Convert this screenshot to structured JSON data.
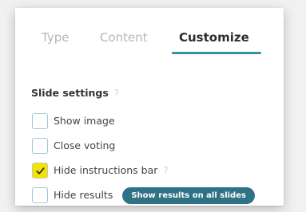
{
  "tabs": [
    {
      "label": "Type",
      "active": false
    },
    {
      "label": "Content",
      "active": false
    },
    {
      "label": "Customize",
      "active": true
    }
  ],
  "colors": {
    "accent": "#3b90a3",
    "pill": "#2f7286",
    "checkbox_checked": "#f3e400",
    "checkbox_border": "#9fc7d6"
  },
  "slide_settings": {
    "title": "Slide settings",
    "help_icon": "?",
    "options": [
      {
        "label": "Show image",
        "checked": false
      },
      {
        "label": "Close voting",
        "checked": false
      },
      {
        "label": "Hide instructions bar",
        "checked": true,
        "help_icon": "?"
      },
      {
        "label": "Hide results",
        "checked": false,
        "button_label": "Show results on all slides"
      }
    ]
  }
}
